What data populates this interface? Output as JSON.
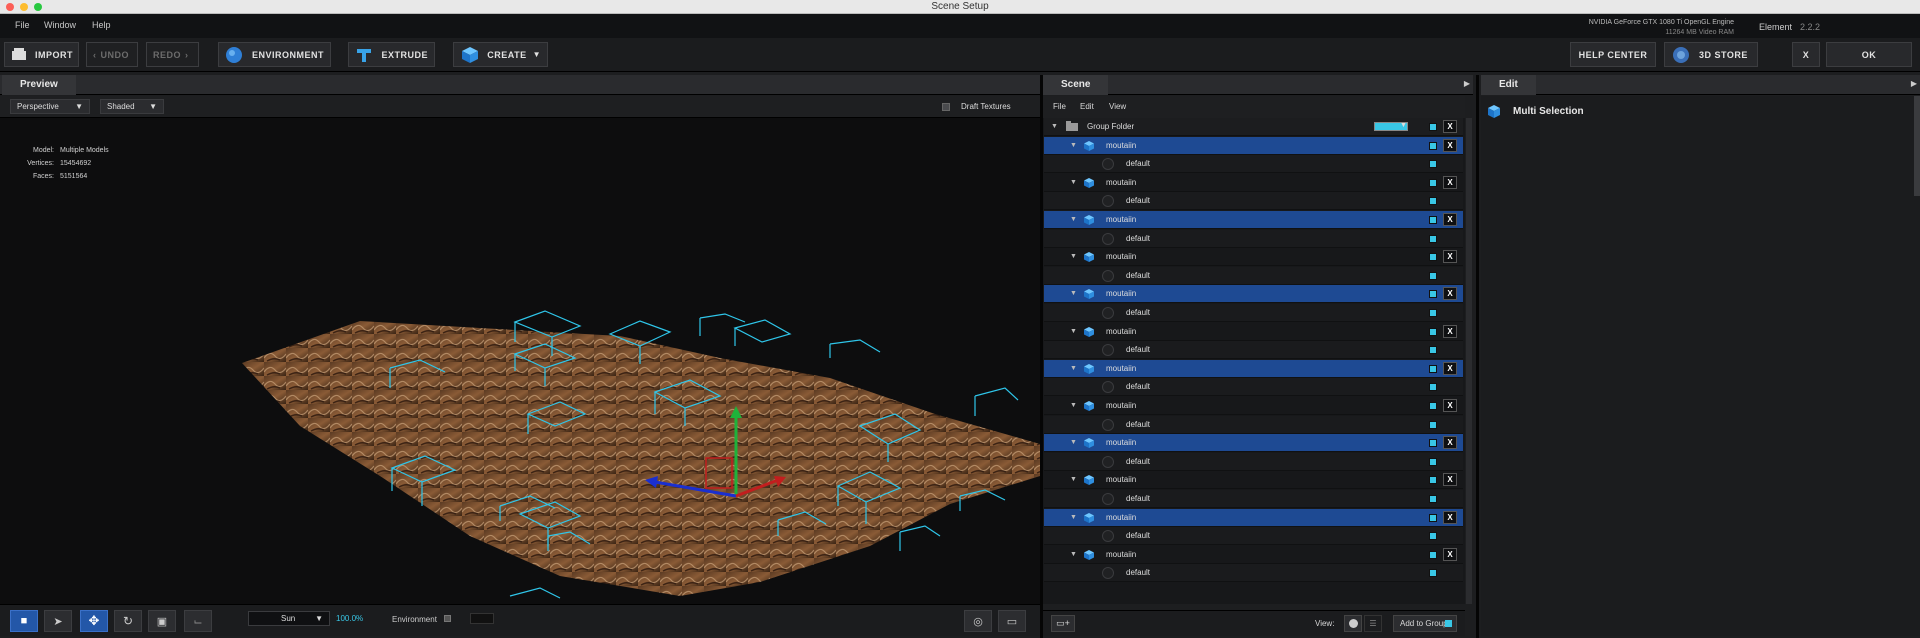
{
  "window": {
    "title": "Scene Setup"
  },
  "menubar": {
    "items": [
      "File",
      "Window",
      "Help"
    ],
    "gpu_line1": "NVIDIA GeForce GTX 1080 Ti OpenGL Engine",
    "gpu_line2": "11264 MB Video RAM",
    "product": "Element",
    "version": "2.2.2"
  },
  "toolbar": {
    "import": "IMPORT",
    "undo": "UNDO",
    "redo": "REDO",
    "environment": "ENVIRONMENT",
    "extrude": "EXTRUDE",
    "create": "CREATE",
    "help_center": "HELP CENTER",
    "store": "3D STORE",
    "close": "X",
    "ok": "OK"
  },
  "preview": {
    "tab": "Preview",
    "camera": "Perspective",
    "shading": "Shaded",
    "draft_textures": "Draft Textures",
    "stats": [
      {
        "label": "Model:",
        "value": "Multiple Models"
      },
      {
        "label": "Vertices:",
        "value": "15454692"
      },
      {
        "label": "Faces:",
        "value": "5151564"
      }
    ],
    "light": "Sun",
    "zoom": "100.0%",
    "environment": "Environment"
  },
  "scene": {
    "tab": "Scene",
    "menu": [
      "File",
      "Edit",
      "View"
    ],
    "group_label": "Group Folder",
    "view_label": "View:",
    "add_to_group": "Add to Group",
    "rows": [
      {
        "name": "moutaiin",
        "sub": "default",
        "selected": true
      },
      {
        "name": "moutaiin",
        "sub": "default",
        "selected": false
      },
      {
        "name": "moutaiin",
        "sub": "default",
        "selected": true
      },
      {
        "name": "moutaiin",
        "sub": "default",
        "selected": false
      },
      {
        "name": "moutaiin",
        "sub": "default",
        "selected": true
      },
      {
        "name": "moutaiin",
        "sub": "default",
        "selected": false
      },
      {
        "name": "moutaiin",
        "sub": "default",
        "selected": true
      },
      {
        "name": "moutaiin",
        "sub": "default",
        "selected": false
      },
      {
        "name": "moutaiin",
        "sub": "default",
        "selected": true
      },
      {
        "name": "moutaiin",
        "sub": "default",
        "selected": false
      },
      {
        "name": "moutaiin",
        "sub": "default",
        "selected": true
      },
      {
        "name": "moutaiin",
        "sub": "default",
        "selected": false
      }
    ],
    "row_x_label": "X"
  },
  "edit": {
    "tab": "Edit",
    "title": "Multi Selection"
  },
  "colors": {
    "accent": "#39c7e6",
    "selection": "#1e4a93",
    "bounds": "#2fc6ea"
  }
}
